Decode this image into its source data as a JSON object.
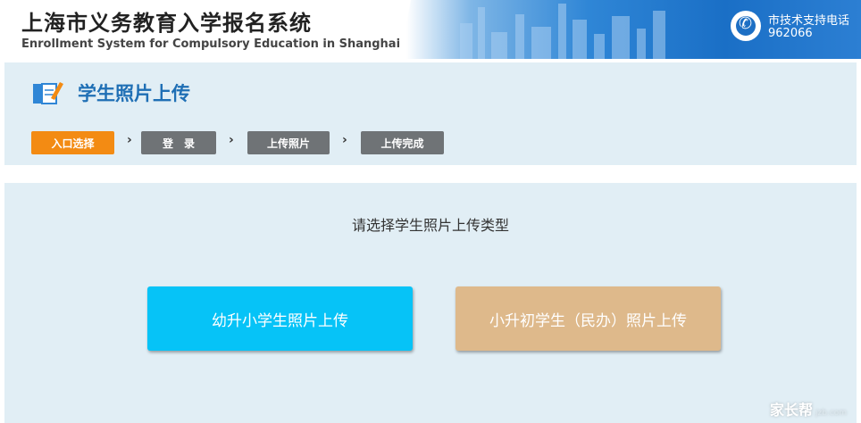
{
  "header": {
    "title_cn": "上海市义务教育入学报名系统",
    "title_en": "Enrollment System for Compulsory Education in Shanghai",
    "support_label": "市技术支持电话",
    "support_number": "962066",
    "accent_color": "#1d6fc4"
  },
  "page": {
    "title": "学生照片上传"
  },
  "steps": [
    {
      "label": "入口选择",
      "state": "active"
    },
    {
      "label": "登　录",
      "state": "inactive"
    },
    {
      "label": "上传照片",
      "state": "inactive"
    },
    {
      "label": "上传完成",
      "state": "inactive"
    }
  ],
  "main": {
    "prompt": "请选择学生照片上传类型",
    "option_kindergarten": "幼升小学生照片上传",
    "option_primary": "小升初学生（民办）照片上传"
  },
  "watermark": {
    "brand": "家长帮",
    "domain": "jzb.com"
  },
  "colors": {
    "step_active": "#f38b13",
    "step_inactive": "#6f7376",
    "panel_bg": "#e1eef5",
    "primary_button": "#06c3f7",
    "secondary_button": "#deb98b",
    "title_blue": "#1f6fb5"
  }
}
